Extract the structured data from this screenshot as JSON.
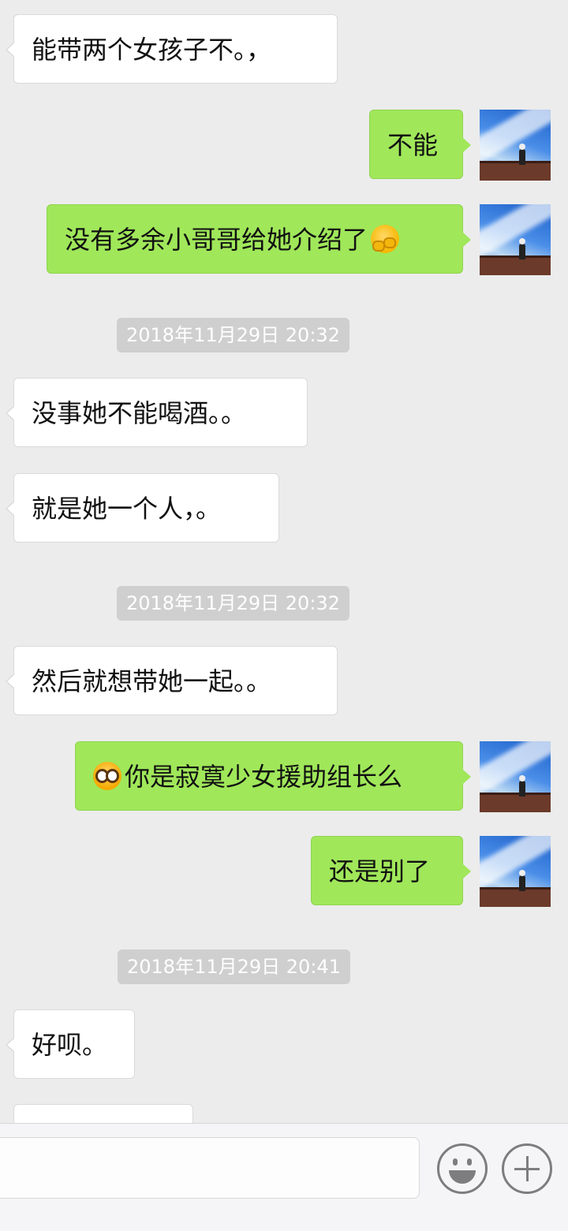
{
  "messages": [
    {
      "type": "incoming",
      "text": "能带两个女孩子不。，"
    },
    {
      "type": "outgoing",
      "text": "不能"
    },
    {
      "type": "outgoing",
      "text": "没有多余小哥哥给她介绍了",
      "emoji_after": "hugging-face-emoji"
    },
    {
      "type": "timestamp",
      "text": "2018年11月29日 20:32"
    },
    {
      "type": "incoming",
      "text": "没事她不能喝酒。。"
    },
    {
      "type": "incoming",
      "text": "就是她一个人，。"
    },
    {
      "type": "timestamp",
      "text": "2018年11月29日 20:32"
    },
    {
      "type": "incoming",
      "text": "然后就想带她一起。。"
    },
    {
      "type": "outgoing",
      "text": "你是寂寞少女援助组长么",
      "emoji_before": "pleading-face-emoji"
    },
    {
      "type": "outgoing",
      "text": "还是别了"
    },
    {
      "type": "timestamp",
      "text": "2018年11月29日 20:41"
    },
    {
      "type": "incoming",
      "text": "好呗。"
    },
    {
      "type": "incoming",
      "text": ""
    }
  ],
  "input_bar": {
    "input_value": "",
    "emoji_button_icon": "smiley-face-icon",
    "more_button_icon": "plus-circle-icon"
  },
  "colors": {
    "background": "#ececec",
    "incoming_bubble": "#ffffff",
    "outgoing_bubble": "#a0e75a",
    "timestamp_bg": "#cfcfcf"
  }
}
